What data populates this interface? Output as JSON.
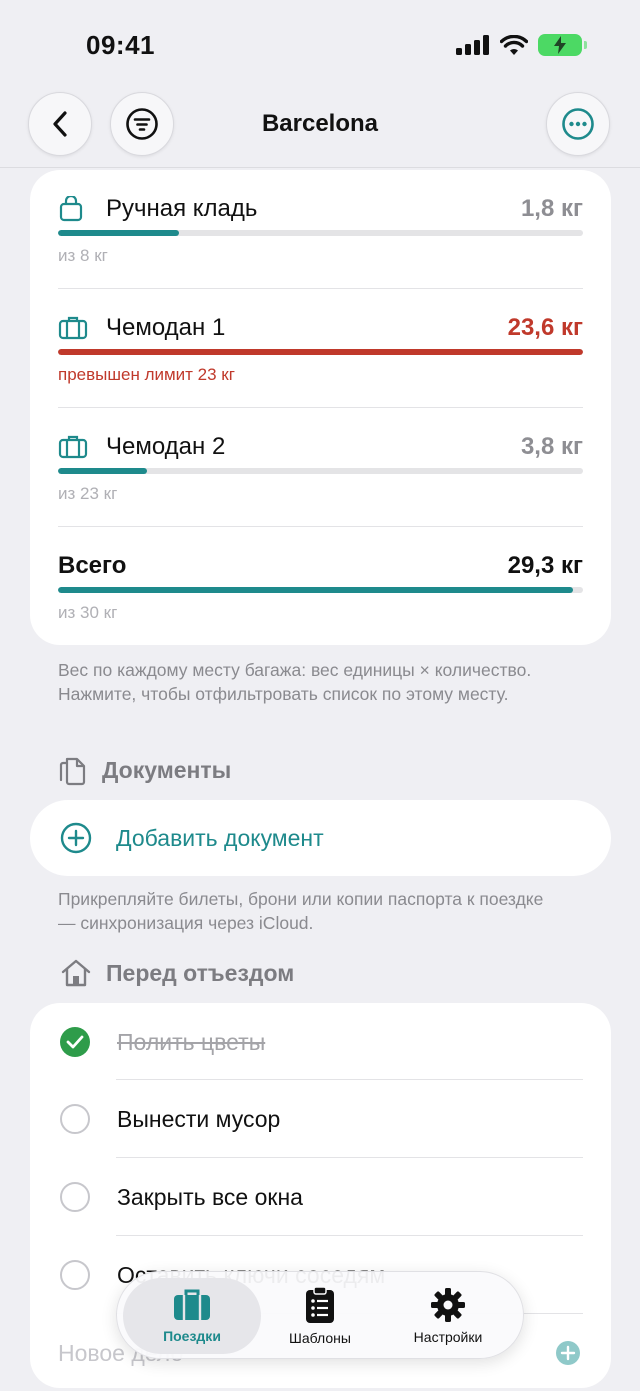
{
  "status_bar": {
    "time": "09:41"
  },
  "nav": {
    "title": "Barcelona"
  },
  "luggage": {
    "items": [
      {
        "name": "Ручная кладь",
        "weight": "1,8 кг",
        "sub": "из 8 кг",
        "fill": 0.23,
        "over": false,
        "icon": "bag-icon"
      },
      {
        "name": "Чемодан 1",
        "weight": "23,6 кг",
        "sub": "превышен лимит 23 кг",
        "fill": 1.0,
        "over": true,
        "icon": "suitcase-icon"
      },
      {
        "name": "Чемодан 2",
        "weight": "3,8 кг",
        "sub": "из 23 кг",
        "fill": 0.17,
        "over": false,
        "icon": "suitcase-icon"
      }
    ],
    "total": {
      "name": "Всего",
      "weight": "29,3 кг",
      "sub": "из 30 кг",
      "fill": 0.98
    },
    "footnote": "Вес по каждому месту багажа: вес единицы × количество. Нажмите, чтобы отфильтровать список по этому месту."
  },
  "documents": {
    "header": "Документы",
    "add_label": "Добавить документ",
    "footnote": "Прикрепляйте билеты, брони или копии паспорта к поездке — синхронизация через iCloud."
  },
  "before_departure": {
    "header": "Перед отъездом",
    "items": [
      {
        "text": "Полить цветы",
        "done": true
      },
      {
        "text": "Вынести мусор",
        "done": false
      },
      {
        "text": "Закрыть все окна",
        "done": false
      },
      {
        "text": "Оставить ключи соседям",
        "done": false
      }
    ],
    "new_item_placeholder": "Новое дело"
  },
  "tab_bar": {
    "tabs": [
      {
        "label": "Поездки",
        "icon": "suitcase-icon",
        "active": true
      },
      {
        "label": "Шаблоны",
        "icon": "clipboard-list-icon",
        "active": false
      },
      {
        "label": "Настройки",
        "icon": "gear-icon",
        "active": false
      }
    ]
  },
  "colors": {
    "accent": "#1e8a8c",
    "danger": "#c0392b",
    "done": "#2e9c4a"
  }
}
